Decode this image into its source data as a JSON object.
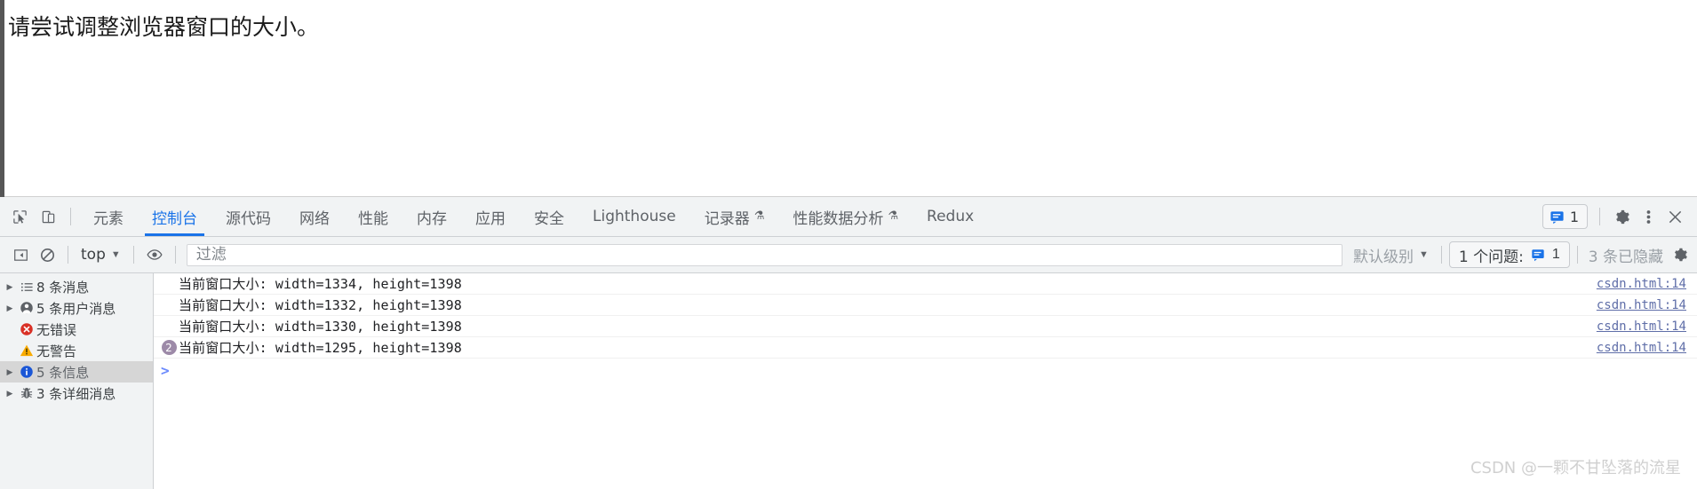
{
  "page": {
    "heading": "请尝试调整浏览器窗口的大小。"
  },
  "devtools": {
    "tabbar": {
      "inspect_icon": "inspect-cursor-icon",
      "device_icon": "device-toolbar-icon",
      "tabs": [
        {
          "label": "元素",
          "active": false,
          "experimental": false
        },
        {
          "label": "控制台",
          "active": true,
          "experimental": false
        },
        {
          "label": "源代码",
          "active": false,
          "experimental": false
        },
        {
          "label": "网络",
          "active": false,
          "experimental": false
        },
        {
          "label": "性能",
          "active": false,
          "experimental": false
        },
        {
          "label": "内存",
          "active": false,
          "experimental": false
        },
        {
          "label": "应用",
          "active": false,
          "experimental": false
        },
        {
          "label": "安全",
          "active": false,
          "experimental": false
        },
        {
          "label": "Lighthouse",
          "active": false,
          "experimental": false
        },
        {
          "label": "记录器",
          "active": false,
          "experimental": true
        },
        {
          "label": "性能数据分析",
          "active": false,
          "experimental": true
        },
        {
          "label": "Redux",
          "active": false,
          "experimental": false
        }
      ],
      "message_badge_count": "1",
      "gear_icon": "settings-gear-icon",
      "kebab_icon": "more-options-icon",
      "close_icon": "close-devtools-icon"
    },
    "console_toolbar": {
      "sidebar_toggle_icon": "console-sidebar-toggle-icon",
      "clear_icon": "clear-console-icon",
      "context_label": "top",
      "eye_icon": "live-expression-eye-icon",
      "filter_placeholder": "过滤",
      "filter_value": "",
      "level_label": "默认级别",
      "issues_label": "1 个问题:",
      "issues_count": "1",
      "hidden_label": "3 条已隐藏",
      "settings_gear_icon": "console-settings-gear-icon"
    },
    "sidebar": {
      "items": [
        {
          "label": "8 条消息",
          "icon": "list-icon",
          "expandable": true,
          "selected": false
        },
        {
          "label": "5 条用户消息",
          "icon": "user-icon",
          "expandable": true,
          "selected": false
        },
        {
          "label": "无错误",
          "icon": "error-icon",
          "expandable": false,
          "selected": false
        },
        {
          "label": "无警告",
          "icon": "warning-icon",
          "expandable": false,
          "selected": false
        },
        {
          "label": "5 条信息",
          "icon": "info-icon",
          "expandable": true,
          "selected": true
        },
        {
          "label": "3 条详细消息",
          "icon": "verbose-bug-icon",
          "expandable": true,
          "selected": false
        }
      ]
    },
    "console_logs": [
      {
        "text": "当前窗口大小: width=1334, height=1398",
        "source": "csdn.html:14",
        "repeat": ""
      },
      {
        "text": "当前窗口大小: width=1332, height=1398",
        "source": "csdn.html:14",
        "repeat": ""
      },
      {
        "text": "当前窗口大小: width=1330, height=1398",
        "source": "csdn.html:14",
        "repeat": ""
      },
      {
        "text": "当前窗口大小: width=1295, height=1398",
        "source": "csdn.html:14",
        "repeat": "2"
      }
    ],
    "prompt": {
      "caret": ">",
      "value": ""
    }
  },
  "watermark": "CSDN @一颗不甘坠落的流星",
  "colors": {
    "accent": "#1a73e8",
    "error": "#d93025",
    "warning": "#f9ab00",
    "info": "#1a73e8",
    "toolbar_bg": "#f1f3f4",
    "link": "#5f6ea8",
    "repeat_badge": "#9d8aa8"
  }
}
